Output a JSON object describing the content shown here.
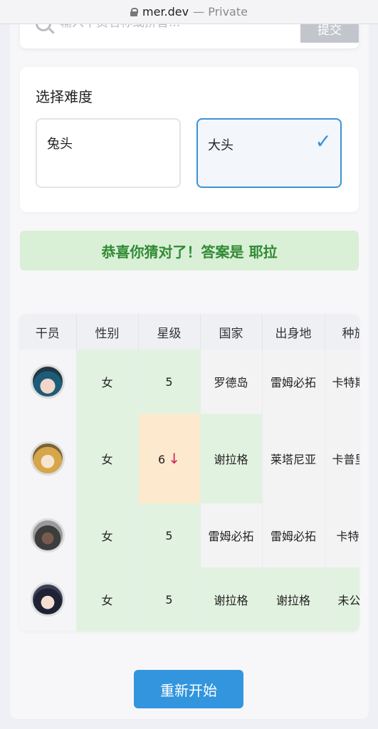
{
  "browser": {
    "domain": "mer.dev",
    "mode": "— Private"
  },
  "search": {
    "placeholder": "输入干员名称或拼音...",
    "submit_label": "提交"
  },
  "difficulty": {
    "title": "选择难度",
    "options": [
      {
        "label": "兔头",
        "selected": false
      },
      {
        "label": "大头",
        "selected": true
      }
    ],
    "check_mark": "✓"
  },
  "banner": {
    "text": "恭喜你猜对了！答案是 耶拉"
  },
  "table": {
    "headers": [
      "干员",
      "性别",
      "星级",
      "国家",
      "出身地",
      "种族"
    ],
    "rows": [
      {
        "gender": "女",
        "stars": "5",
        "stars_arrow": "",
        "country": "罗德岛",
        "origin": "雷姆必拓",
        "race": "卡特斯"
      },
      {
        "gender": "女",
        "stars": "6",
        "stars_arrow": "↓",
        "country": "谢拉格",
        "origin": "莱塔尼亚",
        "race": "卡普里尼"
      },
      {
        "gender": "女",
        "stars": "5",
        "stars_arrow": "",
        "country": "雷姆必拓",
        "origin": "雷姆必拓",
        "race": "卡特斯"
      },
      {
        "gender": "女",
        "stars": "5",
        "stars_arrow": "",
        "country": "谢拉格",
        "origin": "谢拉格",
        "race": "未公开"
      }
    ]
  },
  "restart_label": "重新开始",
  "colors": {
    "accent": "#3295dd",
    "match_green": "#e2f2e0",
    "near_orange": "#fde9cd",
    "success_text": "#2f8a34",
    "arrow_red": "#d0245a"
  }
}
